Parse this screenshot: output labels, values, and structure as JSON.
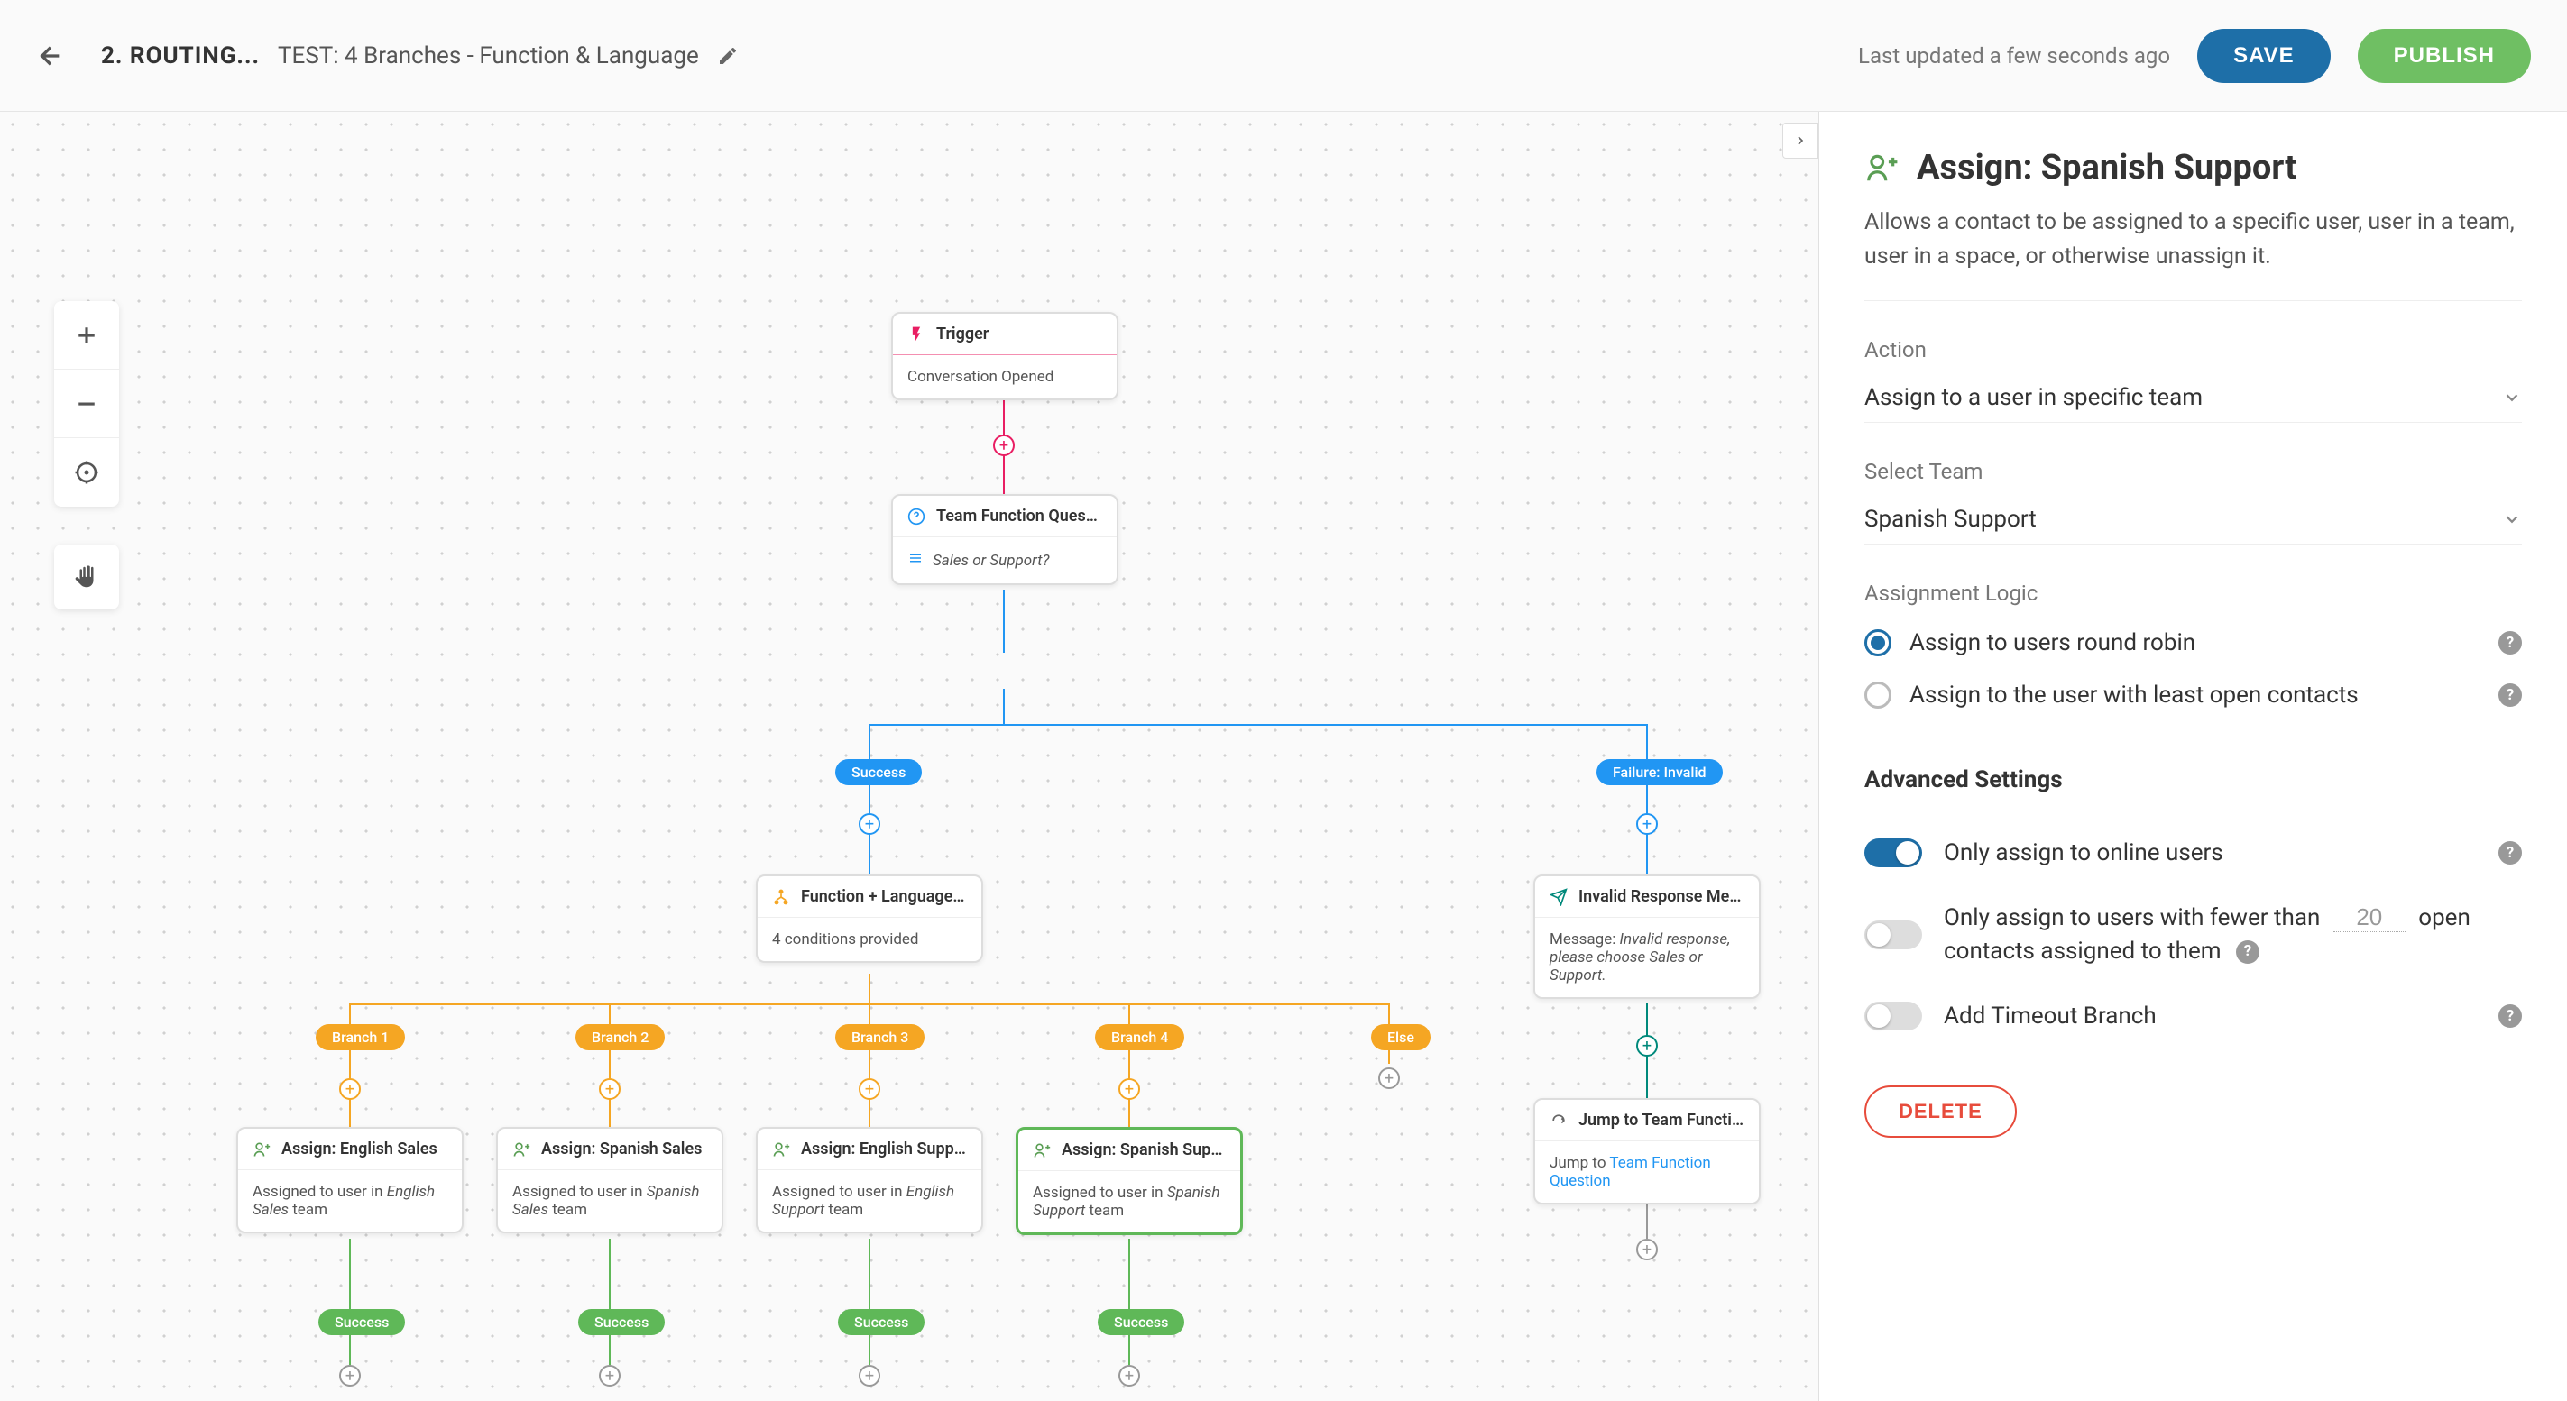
{
  "header": {
    "breadcrumb": "2. ROUTING...",
    "title": "TEST: 4 Branches - Function & Language",
    "last_updated": "Last updated a few seconds ago",
    "save": "SAVE",
    "publish": "PUBLISH"
  },
  "nodes": {
    "trigger": {
      "title": "Trigger",
      "body": "Conversation Opened"
    },
    "question": {
      "title": "Team Function Question",
      "body": "Sales or Support?"
    },
    "branch": {
      "title": "Function + Language Br...",
      "body": "4 conditions provided"
    },
    "invalid": {
      "title": "Invalid Response Messa...",
      "body_prefix": "Message: ",
      "body_italic": "Invalid response, please choose Sales or Support."
    },
    "jump": {
      "title": "Jump to Team Function ...",
      "body_prefix": "Jump to ",
      "body_link": "Team Function Question"
    },
    "assign1": {
      "title": "Assign: English Sales",
      "body_prefix": "Assigned to user in ",
      "team": "English Sales",
      "body_suffix": " team"
    },
    "assign2": {
      "title": "Assign: Spanish Sales",
      "body_prefix": "Assigned to user in ",
      "team": "Spanish Sales",
      "body_suffix": " team"
    },
    "assign3": {
      "title": "Assign: English Support",
      "body_prefix": "Assigned to user in ",
      "team": "English Support",
      "body_suffix": " team"
    },
    "assign4": {
      "title": "Assign: Spanish Support",
      "body_prefix": "Assigned to user in ",
      "team": "Spanish Support",
      "body_suffix": " team"
    }
  },
  "badges": {
    "success": "Success",
    "failure": "Failure: Invalid",
    "b1": "Branch 1",
    "b2": "Branch 2",
    "b3": "Branch 3",
    "b4": "Branch 4",
    "else": "Else",
    "succ": "Success"
  },
  "panel": {
    "title": "Assign: Spanish Support",
    "description": "Allows a contact to be assigned to a specific user, user in a team, user in a space, or otherwise unassign it.",
    "action_label": "Action",
    "action_value": "Assign to a user in specific team",
    "team_label": "Select Team",
    "team_value": "Spanish Support",
    "logic_label": "Assignment Logic",
    "logic_rr": "Assign to users round robin",
    "logic_least": "Assign to the user with least open contacts",
    "advanced_title": "Advanced Settings",
    "tog_online": "Only assign to online users",
    "tog_fewer_pre": "Only assign to users with fewer than ",
    "tog_fewer_val": "20",
    "tog_fewer_post": " open contacts assigned to them",
    "tog_timeout": "Add Timeout Branch",
    "delete": "DELETE"
  }
}
